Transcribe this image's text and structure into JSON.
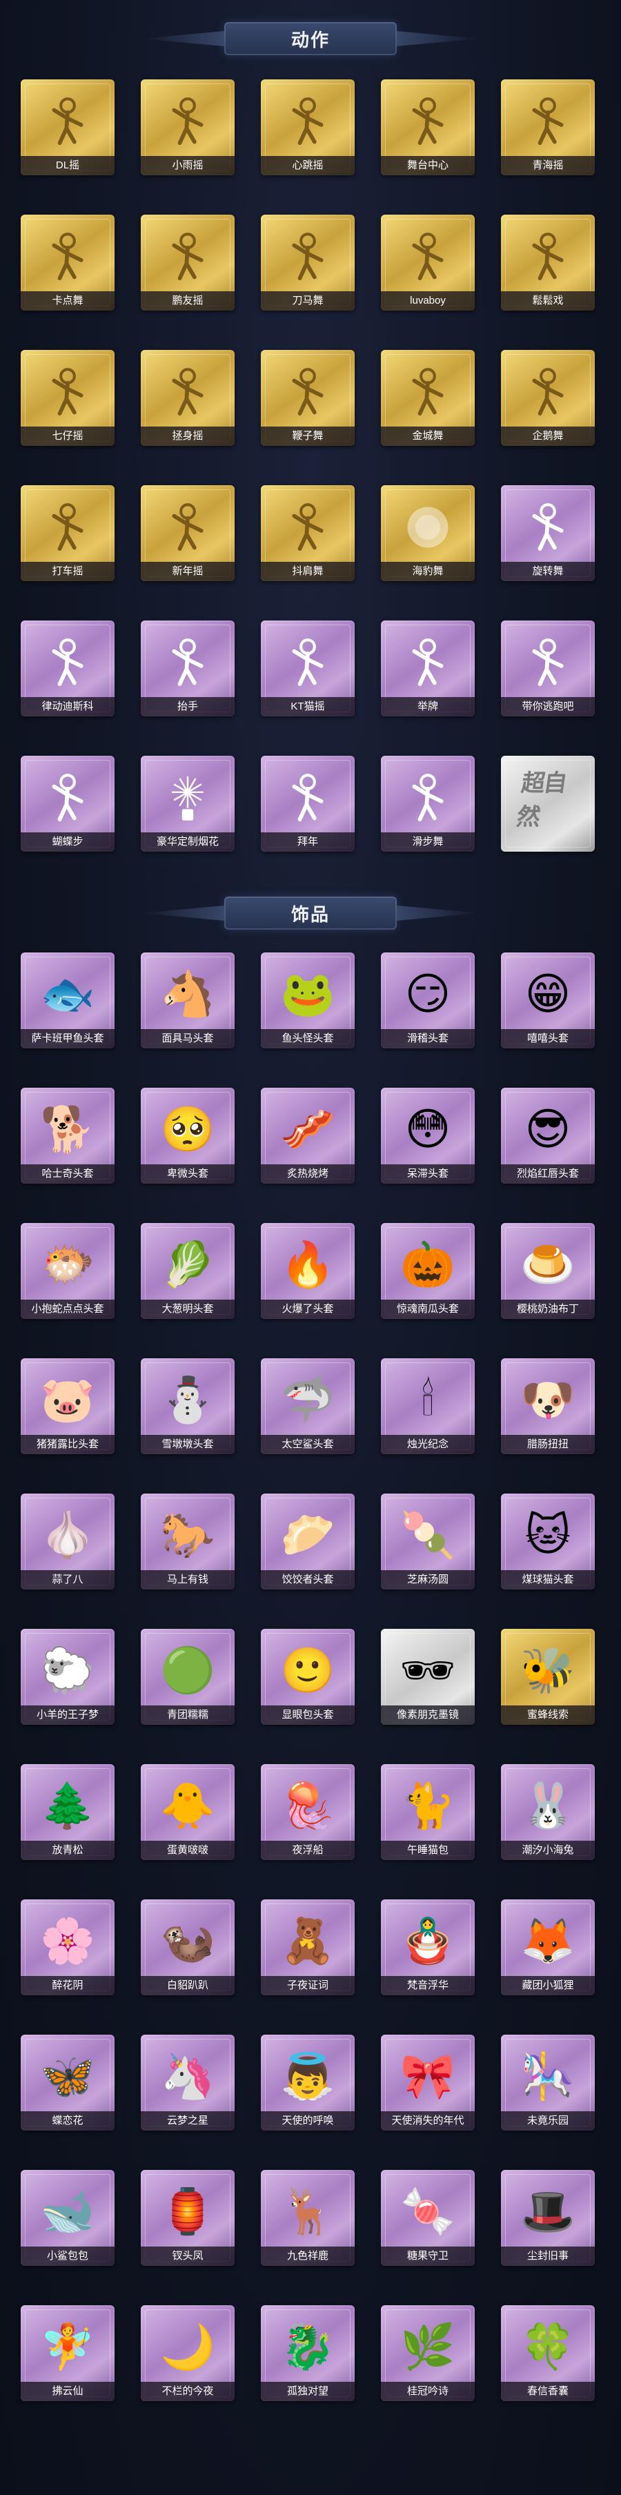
{
  "sections": {
    "actions": {
      "title": "动作",
      "items": [
        {
          "label": "DL摇",
          "style": "gold",
          "icon": "pose-figure-icon"
        },
        {
          "label": "小雨摇",
          "style": "gold",
          "icon": "pose-figure-icon"
        },
        {
          "label": "心跳摇",
          "style": "gold",
          "icon": "pose-figure-icon"
        },
        {
          "label": "舞台中心",
          "style": "gold",
          "icon": "pose-figure-icon"
        },
        {
          "label": "青海摇",
          "style": "gold",
          "icon": "pose-figure-icon"
        },
        {
          "label": "卡点舞",
          "style": "gold",
          "icon": "pose-figure-icon"
        },
        {
          "label": "鹏友摇",
          "style": "gold",
          "icon": "pose-figure-icon"
        },
        {
          "label": "刀马舞",
          "style": "gold",
          "icon": "pose-figure-icon"
        },
        {
          "label": "luvaboy",
          "style": "gold",
          "icon": "pose-figure-icon"
        },
        {
          "label": "鬆鬆戏",
          "style": "gold",
          "icon": "pose-figure-icon"
        },
        {
          "label": "七仔摇",
          "style": "gold",
          "icon": "pose-figure-icon"
        },
        {
          "label": "拯身摇",
          "style": "gold",
          "icon": "pose-figure-icon"
        },
        {
          "label": "鞭子舞",
          "style": "gold",
          "icon": "pose-figure-icon"
        },
        {
          "label": "金城舞",
          "style": "gold",
          "icon": "pose-figure-icon"
        },
        {
          "label": "企鹅舞",
          "style": "gold",
          "icon": "pose-figure-icon"
        },
        {
          "label": "打车摇",
          "style": "gold",
          "icon": "pose-figure-icon"
        },
        {
          "label": "新年摇",
          "style": "gold",
          "icon": "pose-figure-icon"
        },
        {
          "label": "抖肩舞",
          "style": "gold",
          "icon": "pose-figure-icon"
        },
        {
          "label": "海豹舞",
          "style": "gold",
          "icon": "blur-icon"
        },
        {
          "label": "旋转舞",
          "style": "purple",
          "icon": "pose-figure-icon"
        },
        {
          "label": "律动迪斯科",
          "style": "purple",
          "icon": "pose-figure-icon"
        },
        {
          "label": "抬手",
          "style": "purple",
          "icon": "pose-figure-icon"
        },
        {
          "label": "KT猫摇",
          "style": "purple",
          "icon": "pose-figure-icon"
        },
        {
          "label": "举牌",
          "style": "purple",
          "icon": "pose-figure-icon"
        },
        {
          "label": "带你逃跑吧",
          "style": "purple",
          "icon": "pose-figure-icon"
        },
        {
          "label": "蝴蝶步",
          "style": "purple",
          "icon": "pose-figure-icon"
        },
        {
          "label": "豪华定制烟花",
          "style": "purple",
          "icon": "firework-icon"
        },
        {
          "label": "拜年",
          "style": "purple",
          "icon": "pose-figure-icon"
        },
        {
          "label": "滑步舞",
          "style": "purple",
          "icon": "pose-figure-icon"
        },
        {
          "label": "",
          "style": "silver",
          "icon": "chaoranran-logo",
          "logo_text": "超自然"
        }
      ]
    },
    "accessories": {
      "title": "饰品",
      "items": [
        {
          "label": "萨卡班甲鱼头套",
          "style": "purple",
          "icon": "fish-head-icon",
          "glyph": "🐟"
        },
        {
          "label": "面具马头套",
          "style": "purple",
          "icon": "horse-head-icon",
          "glyph": "🐴"
        },
        {
          "label": "鱼头怪头套",
          "style": "purple",
          "icon": "fish-monster-icon",
          "glyph": "🐸"
        },
        {
          "label": "滑稽头套",
          "style": "purple",
          "icon": "smirk-face-icon",
          "glyph": "😏"
        },
        {
          "label": "嘻嘻头套",
          "style": "purple",
          "icon": "grin-face-icon",
          "glyph": "😁"
        },
        {
          "label": "哈士奇头套",
          "style": "purple",
          "icon": "dog-head-icon",
          "glyph": "🐕"
        },
        {
          "label": "卑微头套",
          "style": "purple",
          "icon": "sad-face-icon",
          "glyph": "🥺"
        },
        {
          "label": "炙热烧烤",
          "style": "purple",
          "icon": "sausage-face-icon",
          "glyph": "🥓"
        },
        {
          "label": "呆滞头套",
          "style": "purple",
          "icon": "dazed-face-icon",
          "glyph": "😳"
        },
        {
          "label": "烈焰红唇头套",
          "style": "purple",
          "icon": "pikachu-icon",
          "glyph": "😎"
        },
        {
          "label": "小抱蛇点点头套",
          "style": "purple",
          "icon": "blob-icon",
          "glyph": "🐡"
        },
        {
          "label": "大葱明头套",
          "style": "purple",
          "icon": "bokchoy-icon",
          "glyph": "🥬"
        },
        {
          "label": "火爆了头套",
          "style": "purple",
          "icon": "fire-icon",
          "glyph": "🔥"
        },
        {
          "label": "惊魂南瓜头套",
          "style": "purple",
          "icon": "pumpkin-icon",
          "glyph": "🎃"
        },
        {
          "label": "樱桃奶油布丁",
          "style": "purple",
          "icon": "pudding-icon",
          "glyph": "🍮"
        },
        {
          "label": "猪猪露比头套",
          "style": "purple",
          "icon": "pig-icon",
          "glyph": "🐷"
        },
        {
          "label": "雪墩墩头套",
          "style": "purple",
          "icon": "snowman-icon",
          "glyph": "⛄"
        },
        {
          "label": "太空鲨头套",
          "style": "purple",
          "icon": "shark-icon",
          "glyph": "🦈"
        },
        {
          "label": "烛光纪念",
          "style": "purple",
          "icon": "candle-icon",
          "glyph": "🕯"
        },
        {
          "label": "腊肠扭扭",
          "style": "purple",
          "icon": "dachshund-icon",
          "glyph": "🐶"
        },
        {
          "label": "蒜了八",
          "style": "purple",
          "icon": "garlic-icon",
          "glyph": "🧄"
        },
        {
          "label": "马上有钱",
          "style": "purple",
          "icon": "red-horse-icon",
          "glyph": "🐎"
        },
        {
          "label": "饺饺者头套",
          "style": "purple",
          "icon": "dumpling-icon",
          "glyph": "🥟"
        },
        {
          "label": "芝麻汤圆",
          "style": "purple",
          "icon": "tangyuan-icon",
          "glyph": "🍡"
        },
        {
          "label": "煤球猫头套",
          "style": "purple",
          "icon": "cat-head-icon",
          "glyph": "🐱"
        },
        {
          "label": "小羊的王子梦",
          "style": "purple",
          "icon": "sheep-icon",
          "glyph": "🐑"
        },
        {
          "label": "青团糯糯",
          "style": "purple",
          "icon": "green-ball-icon",
          "glyph": "🟢"
        },
        {
          "label": "显眼包头套",
          "style": "purple",
          "icon": "bun-face-icon",
          "glyph": "🙂"
        },
        {
          "label": "像素朋克墨镜",
          "style": "silver",
          "icon": "pixel-glasses-icon",
          "glyph": "🕶"
        },
        {
          "label": "蜜蜂线索",
          "style": "gold",
          "icon": "bee-doll-icon",
          "glyph": "🐝"
        },
        {
          "label": "放青松",
          "style": "purple",
          "icon": "blur-icon",
          "glyph": "🌲"
        },
        {
          "label": "蛋黄啵啵",
          "style": "purple",
          "icon": "chick-icon",
          "glyph": "🐥"
        },
        {
          "label": "夜浮船",
          "style": "purple",
          "icon": "jellyfish-icon",
          "glyph": "🪼"
        },
        {
          "label": "午睡猫包",
          "style": "purple",
          "icon": "cat-bag-icon",
          "glyph": "🐈"
        },
        {
          "label": "潮汐小海兔",
          "style": "purple",
          "icon": "sea-bunny-icon",
          "glyph": "🐰"
        },
        {
          "label": "醉花阴",
          "style": "purple",
          "icon": "flower-pendant-icon",
          "glyph": "🌸"
        },
        {
          "label": "白貂趴趴",
          "style": "purple",
          "icon": "ferret-icon",
          "glyph": "🦦"
        },
        {
          "label": "子夜证词",
          "style": "purple",
          "icon": "doll-icon",
          "glyph": "🧸"
        },
        {
          "label": "梵音浮华",
          "style": "purple",
          "icon": "doll-icon",
          "glyph": "🪆"
        },
        {
          "label": "藏团小狐狸",
          "style": "purple",
          "icon": "fox-icon",
          "glyph": "🦊"
        },
        {
          "label": "蝶恋花",
          "style": "purple",
          "icon": "butterfly-icon",
          "glyph": "🦋"
        },
        {
          "label": "云梦之星",
          "style": "purple",
          "icon": "unicorn-icon",
          "glyph": "🦄"
        },
        {
          "label": "天使的呼唤",
          "style": "purple",
          "icon": "angel-icon",
          "glyph": "👼"
        },
        {
          "label": "天使消失的年代",
          "style": "purple",
          "icon": "doll-icon",
          "glyph": "🎀"
        },
        {
          "label": "未竟乐园",
          "style": "purple",
          "icon": "doll-icon",
          "glyph": "🎠"
        },
        {
          "label": "小鲨包包",
          "style": "purple",
          "icon": "shark-bag-icon",
          "glyph": "🐋"
        },
        {
          "label": "钗头凤",
          "style": "purple",
          "icon": "doll-icon",
          "glyph": "🏮"
        },
        {
          "label": "九色祥鹿",
          "style": "purple",
          "icon": "deer-icon",
          "glyph": "🦌"
        },
        {
          "label": "糖果守卫",
          "style": "purple",
          "icon": "candy-icon",
          "glyph": "🍬"
        },
        {
          "label": "尘封旧事",
          "style": "purple",
          "icon": "doll-icon",
          "glyph": "🎩"
        },
        {
          "label": "拂云仙",
          "style": "purple",
          "icon": "fairy-icon",
          "glyph": "🧚"
        },
        {
          "label": "不栏的今夜",
          "style": "purple",
          "icon": "doll-icon",
          "glyph": "🌙"
        },
        {
          "label": "孤独对望",
          "style": "purple",
          "icon": "doll-icon",
          "glyph": "🐉"
        },
        {
          "label": "桂冠吟诗",
          "style": "purple",
          "icon": "doll-icon",
          "glyph": "🌿"
        },
        {
          "label": "春信香囊",
          "style": "purple",
          "icon": "sachet-icon",
          "glyph": "🍀"
        }
      ]
    }
  }
}
